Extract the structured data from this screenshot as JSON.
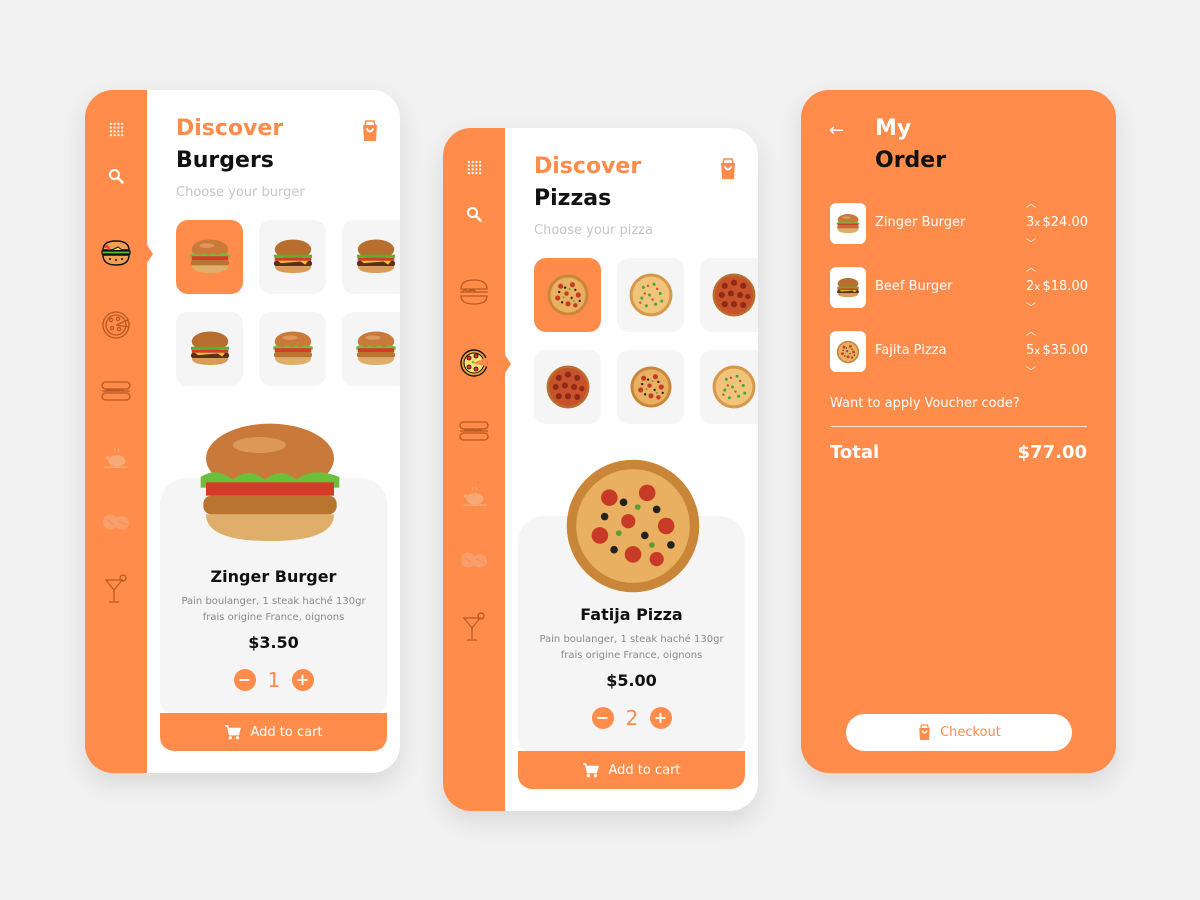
{
  "colors": {
    "accent": "#ff8c4b",
    "background": "#f1f1f1",
    "card": "#f5f5f5"
  },
  "burgers_screen": {
    "title_accent": "Discover",
    "title": "Burgers",
    "subtitle": "Choose your burger",
    "sidebar": {
      "icons": [
        "menu-grid-icon",
        "search-icon",
        "burger-icon",
        "pizza-icon",
        "hotdog-icon",
        "chicken-icon",
        "meat-icon",
        "cocktail-icon"
      ],
      "active": "burger-icon"
    },
    "thumbnails": [
      "Zinger burger",
      "Cheeseburger",
      "Double cheeseburger",
      "Stacked burger",
      "Classic burger",
      "Chicken burger"
    ],
    "selected_index": 0,
    "product": {
      "name": "Zinger Burger",
      "description": "Pain boulanger, 1 steak haché 130gr frais origine France, oignons",
      "price": "$3.50",
      "quantity": "1"
    },
    "add_to_cart": "Add to cart"
  },
  "pizzas_screen": {
    "title_accent": "Discover",
    "title": "Pizzas",
    "subtitle": "Choose your pizza",
    "sidebar": {
      "icons": [
        "menu-grid-icon",
        "search-icon",
        "burger-icon",
        "pizza-icon",
        "hotdog-icon",
        "chicken-icon",
        "meat-icon",
        "cocktail-icon"
      ],
      "active": "pizza-icon"
    },
    "thumbnails": [
      "Fajita pizza",
      "Vegetable pizza",
      "Pepperoni pizza",
      "Pepperoni classic",
      "Supreme pizza",
      "Garden pizza"
    ],
    "selected_index": 0,
    "product": {
      "name": "Fatija Pizza",
      "description": "Pain boulanger, 1 steak haché 130gr frais origine France, oignons",
      "price": "$5.00",
      "quantity": "2"
    },
    "add_to_cart": "Add to cart"
  },
  "order_screen": {
    "title_line1": "My",
    "title_line2": "Order",
    "items": [
      {
        "name": "Zinger Burger",
        "qty": "3",
        "qty_suffix": "x",
        "price": "$24.00"
      },
      {
        "name": "Beef Burger",
        "qty": "2",
        "qty_suffix": "x",
        "price": "$18.00"
      },
      {
        "name": "Fajita Pizza",
        "qty": "5",
        "qty_suffix": "x",
        "price": "$35.00"
      }
    ],
    "voucher_prompt": "Want to apply Voucher code?",
    "total_label": "Total",
    "total_value": "$77.00",
    "checkout_label": "Checkout"
  }
}
